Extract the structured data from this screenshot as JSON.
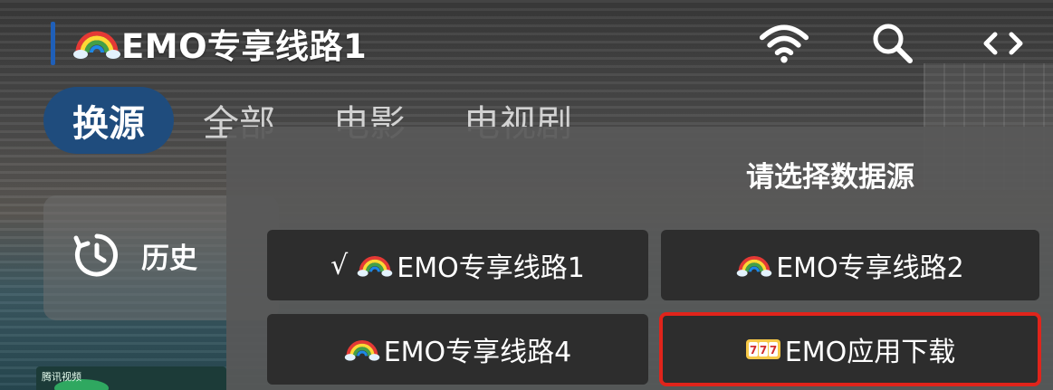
{
  "header": {
    "title": "EMO专享线路1"
  },
  "icons": {
    "wifi": "wifi-icon",
    "search": "search-icon",
    "code": "code-brackets-icon",
    "history": "history-icon"
  },
  "tabs": [
    {
      "label": "换源",
      "active": true
    },
    {
      "label": "全部"
    },
    {
      "label": "电影"
    },
    {
      "label": "电视剧"
    }
  ],
  "history": {
    "label": "历史"
  },
  "thumbnail": {
    "badge": "腾讯视频"
  },
  "dialog": {
    "title": "请选择数据源",
    "options": [
      {
        "check": "√",
        "label": "EMO专享线路1",
        "selected": true
      },
      {
        "check": "",
        "label": "EMO专享线路2"
      },
      {
        "check": "",
        "label": "EMO专享线路4"
      },
      {
        "check": "",
        "label": "EMO应用下载",
        "focused": true
      }
    ]
  },
  "colors": {
    "accent": "#1f5fb8",
    "active_tab": "#1f4c7d",
    "focus_outline": "#e0241b",
    "option_bg": "#2d2d2d"
  }
}
